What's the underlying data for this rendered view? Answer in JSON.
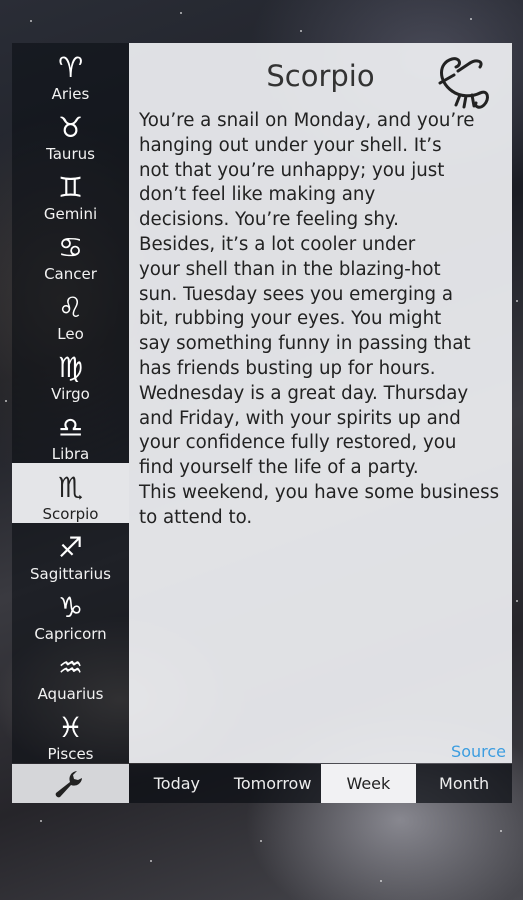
{
  "sidebar": {
    "signs": [
      {
        "label": "Aries",
        "icon": "aries-icon",
        "glyph": "♈"
      },
      {
        "label": "Taurus",
        "icon": "taurus-icon",
        "glyph": "♉"
      },
      {
        "label": "Gemini",
        "icon": "gemini-icon",
        "glyph": "♊"
      },
      {
        "label": "Cancer",
        "icon": "cancer-icon",
        "glyph": "♋"
      },
      {
        "label": "Leo",
        "icon": "leo-icon",
        "glyph": "♌"
      },
      {
        "label": "Virgo",
        "icon": "virgo-icon",
        "glyph": "♍"
      },
      {
        "label": "Libra",
        "icon": "libra-icon",
        "glyph": "♎"
      },
      {
        "label": "Scorpio",
        "icon": "scorpio-icon",
        "glyph": "♏"
      },
      {
        "label": "Sagittarius",
        "icon": "sagittarius-icon",
        "glyph": "♐"
      },
      {
        "label": "Capricorn",
        "icon": "capricorn-icon",
        "glyph": "♑"
      },
      {
        "label": "Aquarius",
        "icon": "aquarius-icon",
        "glyph": "♒"
      },
      {
        "label": "Pisces",
        "icon": "pisces-icon",
        "glyph": "♓"
      }
    ],
    "selected": "Scorpio",
    "settings_icon": "wrench-icon"
  },
  "horoscope": {
    "title": "Scorpio",
    "title_icon": "scorpion-icon",
    "text": "You’re a snail on Monday, and you’re\nhanging out under your shell. It’s\nnot that you’re unhappy; you just\ndon’t feel like making any\ndecisions. You’re feeling shy.\nBesides, it’s a lot cooler under\nyour shell than in the blazing-hot\nsun. Tuesday sees you emerging a\nbit, rubbing your eyes. You might\nsay something funny in passing that\nhas friends busting up for hours.\nWednesday is a great day. Thursday\nand Friday, with your spirits up and\nyour confidence fully restored, you\nfind yourself the life of a party.\nThis weekend, you have some business\nto attend to.",
    "source_label": "Source"
  },
  "tabs": [
    {
      "label": "Today"
    },
    {
      "label": "Tomorrow"
    },
    {
      "label": "Week"
    },
    {
      "label": "Month"
    }
  ],
  "active_tab": "Week",
  "colors": {
    "panel_bg": "#eeeff2",
    "source_link": "#3c9de0",
    "selected_bg": "#e4e5e8"
  }
}
